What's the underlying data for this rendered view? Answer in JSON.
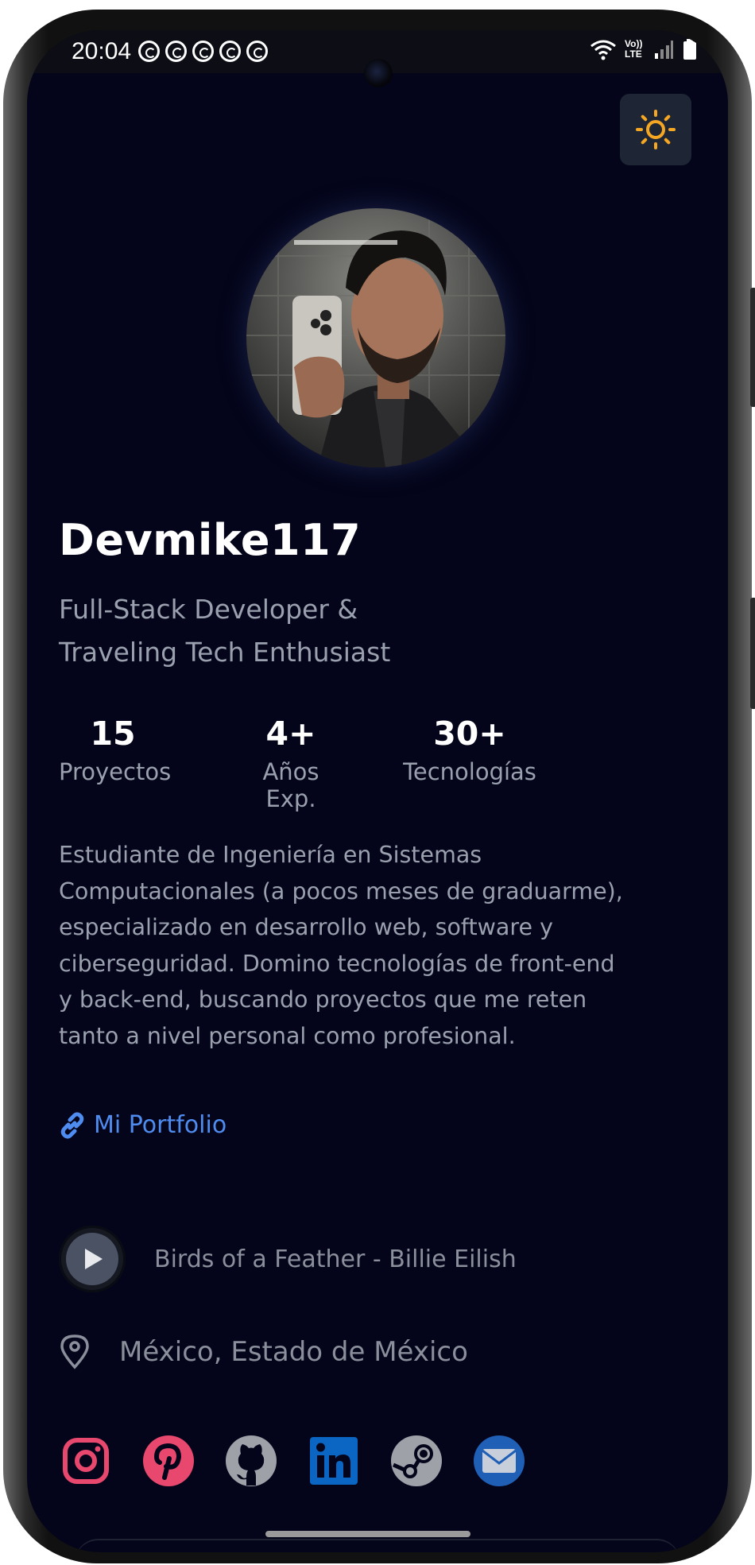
{
  "status_bar": {
    "time": "20:04",
    "notification_icons": [
      "whatsapp-icon",
      "whatsapp-icon",
      "whatsapp-icon",
      "whatsapp-icon",
      "whatsapp-icon"
    ],
    "network_label": "Vo)) LTE"
  },
  "profile": {
    "name": "Devmike117",
    "subtitle": "Full-Stack Developer & Traveling Tech Enthusiast",
    "stats": [
      {
        "value": "15",
        "label": "Proyectos"
      },
      {
        "value": "4+",
        "label": "Años Exp."
      },
      {
        "value": "30+",
        "label": "Tecnologías"
      }
    ],
    "about": "Estudiante de Ingeniería en Sistemas Computacionales (a pocos meses de graduarme), especializado en desarrollo web, software y ciberseguridad. Domino tecnologías de front-end y back-end, buscando proyectos que me reten tanto a nivel personal como profesional.",
    "portfolio_label": "Mi Portfolio",
    "song": "Birds of a Feather - Billie Eilish",
    "location": "México, Estado de México"
  },
  "socials": [
    {
      "icon": "instagram-icon",
      "color": "#e8476e"
    },
    {
      "icon": "pinterest-icon",
      "color": "#e8476e"
    },
    {
      "icon": "github-icon",
      "color": "#9ea1a8"
    },
    {
      "icon": "linkedin-icon",
      "color": "#0a66c2"
    },
    {
      "icon": "steam-icon",
      "color": "#9ea1a8"
    },
    {
      "icon": "email-icon",
      "color": "#1f5fb5"
    }
  ],
  "colors": {
    "background": "#04051a",
    "accent_link": "#4f8cf0",
    "theme_icon": "#f5a623",
    "muted_text": "#9aa0ae"
  }
}
